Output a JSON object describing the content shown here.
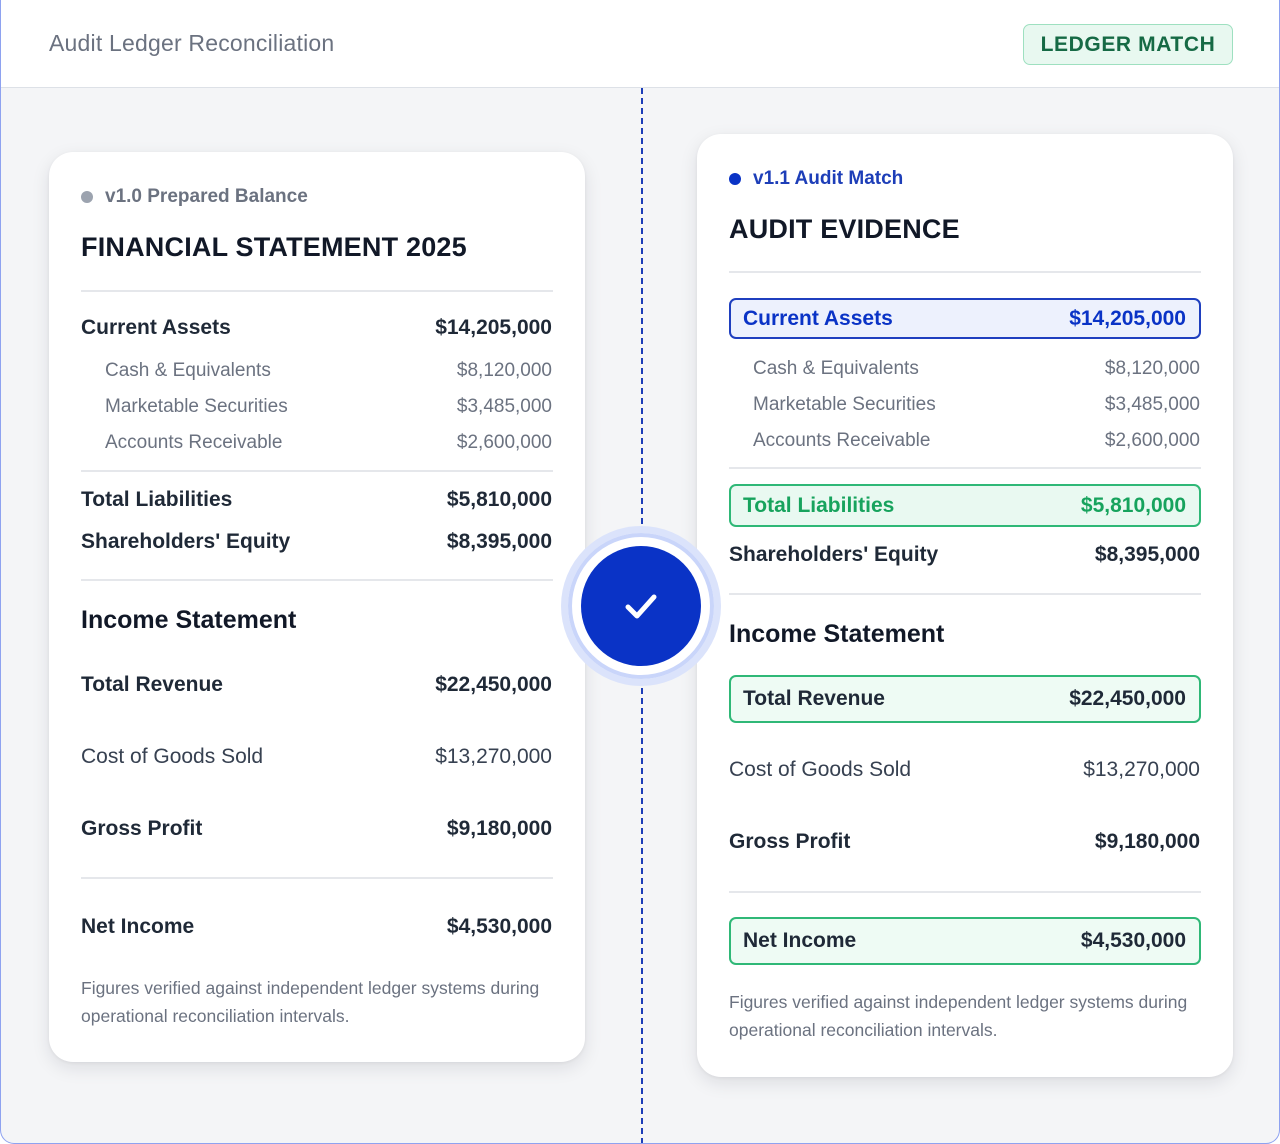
{
  "header": {
    "title": "Audit Ledger Reconciliation",
    "badge": "LEDGER MATCH"
  },
  "colors": {
    "accent_blue": "#0a33c6",
    "match_green": "#17a35d",
    "badge_green_text": "#166a45"
  },
  "left_card": {
    "version": "v1.0 Prepared Balance",
    "title": "FINANCIAL STATEMENT 2025",
    "current_assets": {
      "label": "Current Assets",
      "value": "$14,205,000"
    },
    "sub_items": [
      {
        "label": "Cash & Equivalents",
        "value": "$8,120,000"
      },
      {
        "label": "Marketable Securities",
        "value": "$3,485,000"
      },
      {
        "label": "Accounts Receivable",
        "value": "$2,600,000"
      }
    ],
    "total_liabilities": {
      "label": "Total Liabilities",
      "value": "$5,810,000"
    },
    "equity": {
      "label": "Shareholders' Equity",
      "value": "$8,395,000"
    },
    "income_heading": "Income Statement",
    "total_revenue": {
      "label": "Total Revenue",
      "value": "$22,450,000"
    },
    "cogs": {
      "label": "Cost of Goods Sold",
      "value": "$13,270,000"
    },
    "gross_profit": {
      "label": "Gross Profit",
      "value": "$9,180,000"
    },
    "net_income": {
      "label": "Net Income",
      "value": "$4,530,000"
    },
    "footnote": "Figures verified against independent ledger systems during operational reconciliation intervals."
  },
  "right_card": {
    "version": "v1.1 Audit Match",
    "title": "AUDIT EVIDENCE",
    "current_assets": {
      "label": "Current Assets",
      "value": "$14,205,000"
    },
    "sub_items": [
      {
        "label": "Cash & Equivalents",
        "value": "$8,120,000"
      },
      {
        "label": "Marketable Securities",
        "value": "$3,485,000"
      },
      {
        "label": "Accounts Receivable",
        "value": "$2,600,000"
      }
    ],
    "total_liabilities": {
      "label": "Total Liabilities",
      "value": "$5,810,000"
    },
    "equity": {
      "label": "Shareholders' Equity",
      "value": "$8,395,000"
    },
    "income_heading": "Income Statement",
    "total_revenue": {
      "label": "Total Revenue",
      "value": "$22,450,000"
    },
    "cogs": {
      "label": "Cost of Goods Sold",
      "value": "$13,270,000"
    },
    "gross_profit": {
      "label": "Gross Profit",
      "value": "$9,180,000"
    },
    "net_income": {
      "label": "Net Income",
      "value": "$4,530,000"
    },
    "footnote": "Figures verified against independent ledger systems during operational reconciliation intervals."
  },
  "match_indicator": {
    "icon": "check-icon"
  }
}
